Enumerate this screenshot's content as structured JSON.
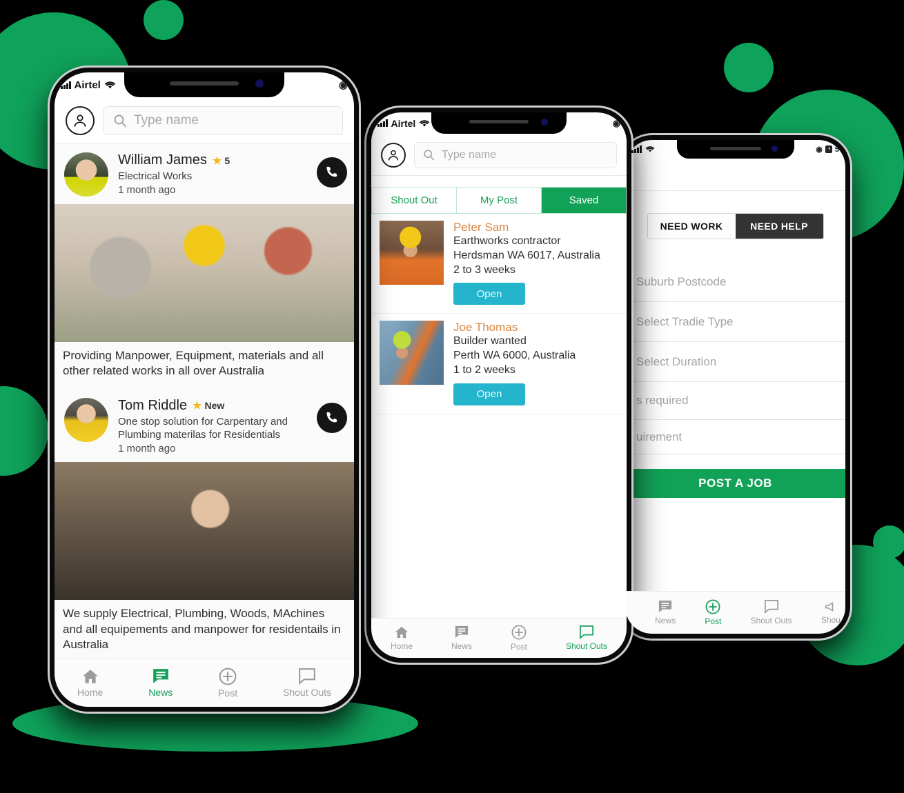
{
  "theme": {
    "green": "#0FA25A",
    "green_dark": "#12A257",
    "cyan": "#24B4CC",
    "orange": "#D98642",
    "star_yellow": "#F6B91A",
    "dark": "#333333"
  },
  "phone1": {
    "status": {
      "carrier": "Airtel",
      "icons": [
        "signal-bars-icon",
        "wifi-icon",
        "camera-dot-icon"
      ]
    },
    "header": {
      "avatar": "profile-avatar-icon",
      "search_placeholder": "Type name",
      "search_value": ""
    },
    "posts": [
      {
        "name": "William James",
        "badge": "5",
        "badge_icon": "star-icon",
        "subtitle": "Electrical Works",
        "time": "1 month ago",
        "call_icon": "phone-call-icon",
        "image": "workers-group-photo",
        "caption": "Providing Manpower, Equipment, materials and all other related works in all over Australia"
      },
      {
        "name": "Tom Riddle",
        "badge": "New",
        "badge_icon": "star-icon",
        "subtitle": "One stop solution for Carpentary and Plumbing materilas for Residentials",
        "time": "1 month ago",
        "call_icon": "phone-call-icon",
        "image": "tradesman-workshop-photo",
        "caption": "We supply Electrical, Plumbing, Woods, MAchines and all equipements and manpower for residentails in Australia"
      }
    ],
    "nav": [
      {
        "label": "Home",
        "icon": "home-icon",
        "active": false
      },
      {
        "label": "News",
        "icon": "news-feed-icon",
        "active": true
      },
      {
        "label": "Post",
        "icon": "plus-circle-icon",
        "active": false
      },
      {
        "label": "Shout Outs",
        "icon": "chat-bubble-icon",
        "active": false
      }
    ]
  },
  "phone2": {
    "status": {
      "carrier": "Airtel",
      "icons": [
        "signal-bars-icon",
        "wifi-icon",
        "camera-dot-icon"
      ]
    },
    "header": {
      "avatar": "profile-avatar-icon",
      "search_placeholder": "Type name",
      "search_value": ""
    },
    "tabs": [
      {
        "label": "Shout Out",
        "active": false
      },
      {
        "label": "My Post",
        "active": false
      },
      {
        "label": "Saved",
        "active": true
      }
    ],
    "jobs": [
      {
        "name": "Peter Sam",
        "role": "Earthworks contractor",
        "location": "Herdsman WA 6017, Australia",
        "duration": "2 to 3 weeks",
        "button": "Open",
        "thumb": "hivis-worker-photo"
      },
      {
        "name": "Joe Thomas",
        "role": "Builder wanted",
        "location": "Perth WA 6000, Australia",
        "duration": "1 to 2 weeks",
        "button": "Open",
        "thumb": "scaffold-worker-photo"
      }
    ],
    "nav": [
      {
        "label": "Home",
        "icon": "home-icon",
        "active": false
      },
      {
        "label": "News",
        "icon": "news-feed-icon",
        "active": false
      },
      {
        "label": "Post",
        "icon": "plus-circle-icon",
        "active": false
      },
      {
        "label": "Shout Outs",
        "icon": "chat-bubble-icon",
        "active": true
      }
    ]
  },
  "phone3": {
    "status": {
      "carrier": "",
      "icons": [
        "signal-bars-icon",
        "wifi-icon",
        "location-icon",
        "alarm-icon",
        "battery-icon"
      ]
    },
    "toggle": [
      {
        "label": "NEED WORK",
        "active": false
      },
      {
        "label": "NEED HELP",
        "active": true
      }
    ],
    "fields": [
      {
        "placeholder": "Suburb Postcode",
        "value": ""
      },
      {
        "placeholder": "Select Tradie Type",
        "value": ""
      },
      {
        "placeholder": "Select Duration",
        "value": ""
      },
      {
        "placeholder": "s required",
        "value": ""
      },
      {
        "placeholder": "uirement",
        "value": ""
      }
    ],
    "submit": "POST A JOB",
    "nav": [
      {
        "label": "News",
        "icon": "news-feed-icon",
        "active": false
      },
      {
        "label": "Post",
        "icon": "plus-circle-icon",
        "active": true
      },
      {
        "label": "Shout Outs",
        "icon": "chat-bubble-icon",
        "active": false
      },
      {
        "label": "Shou",
        "icon": "megaphone-icon",
        "active": false
      }
    ]
  }
}
